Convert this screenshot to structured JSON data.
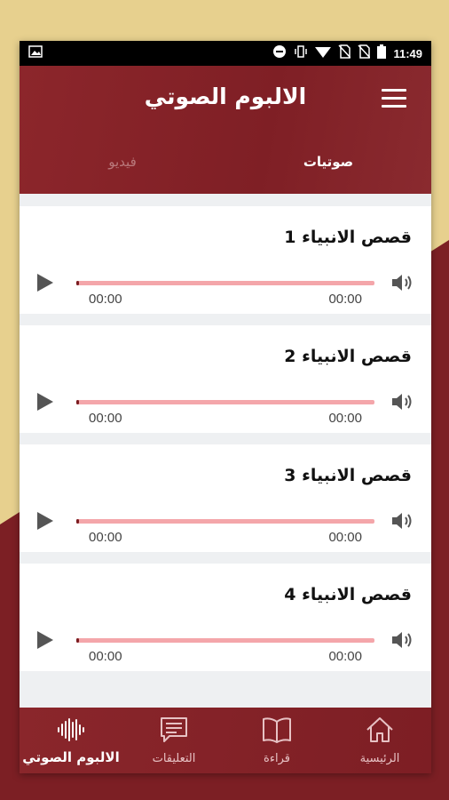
{
  "colors": {
    "accent": "#7f1f25",
    "track": "#f4a6aa",
    "background_yellow": "#e7d08e"
  },
  "status_bar": {
    "time": "11:49"
  },
  "app_bar": {
    "title": "الالبوم الصوتي",
    "menu_icon": "hamburger-menu-icon"
  },
  "tabs": [
    {
      "label": "صوتيات",
      "active": true
    },
    {
      "label": "فيديو",
      "active": false
    }
  ],
  "tracks": [
    {
      "title": "قصص الانبياء 1",
      "current_time": "00:00",
      "duration": "00:00",
      "progress": 0
    },
    {
      "title": "قصص الانبياء 2",
      "current_time": "00:00",
      "duration": "00:00",
      "progress": 0
    },
    {
      "title": "قصص الانبياء 3",
      "current_time": "00:00",
      "duration": "00:00",
      "progress": 0
    },
    {
      "title": "قصص الانبياء 4",
      "current_time": "00:00",
      "duration": "00:00",
      "progress": 0
    }
  ],
  "bottom_nav": [
    {
      "label": "الرئيسية",
      "icon": "home-icon",
      "active": false
    },
    {
      "label": "قراءة",
      "icon": "book-icon",
      "active": false
    },
    {
      "label": "التعليقات",
      "icon": "comments-icon",
      "active": false
    },
    {
      "label": "الالبوم الصوتي",
      "icon": "audio-wave-icon",
      "active": true
    }
  ]
}
